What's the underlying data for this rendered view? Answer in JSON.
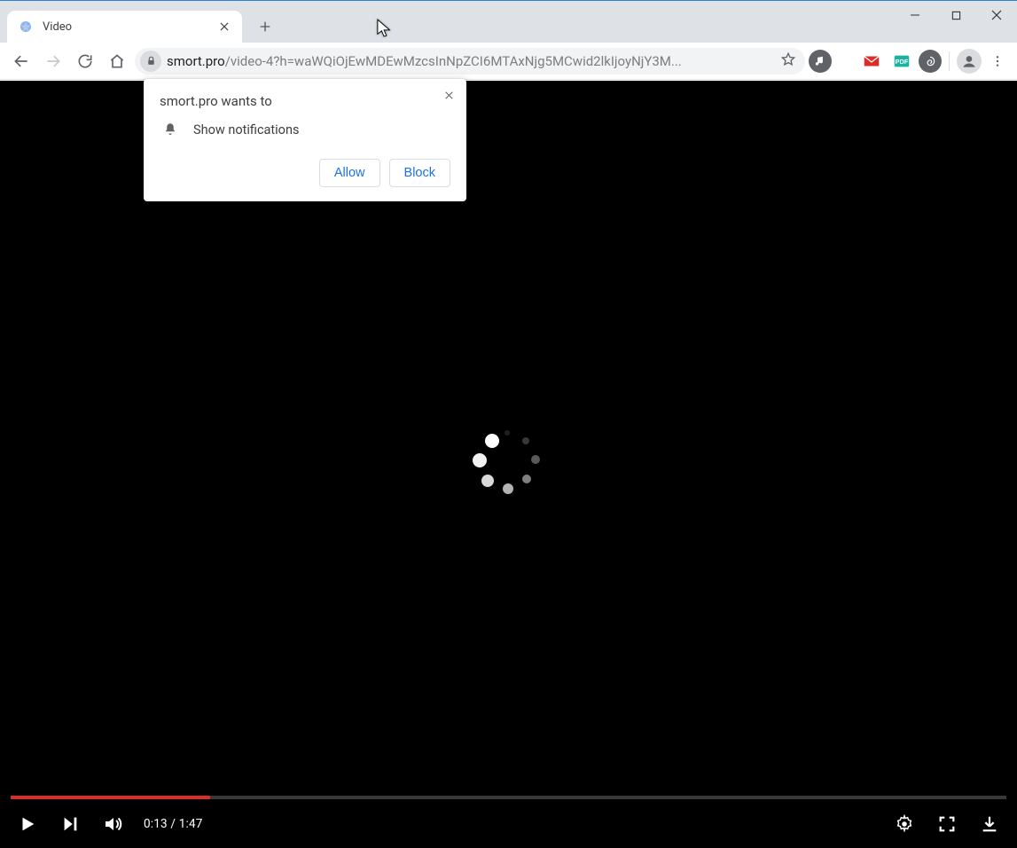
{
  "window": {},
  "tab": {
    "title": "Video"
  },
  "address": {
    "host": "smort.pro",
    "path": "/video-4?h=waWQiOjEwMDEwMzcsInNpZCI6MTAxNjg5MCwid2lkIjoyNjY3M..."
  },
  "permission": {
    "title": "smort.pro wants to",
    "item": "Show notifications",
    "allow": "Allow",
    "block": "Block"
  },
  "player": {
    "current": "0:13",
    "sep": " / ",
    "duration": "1:47"
  }
}
